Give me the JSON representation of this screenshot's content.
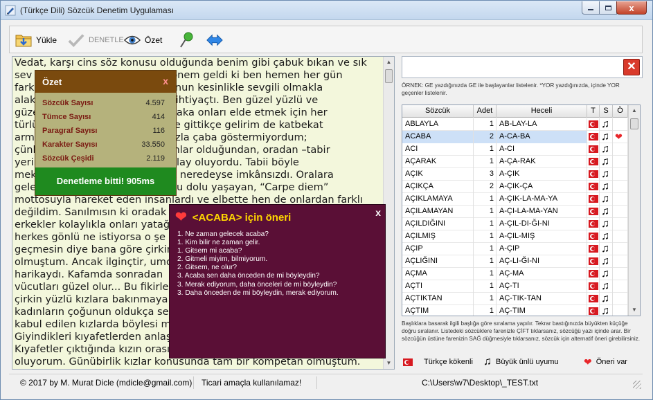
{
  "window": {
    "title": "(Türkçe Dili) Sözcük Denetim Uygulaması",
    "close_glyph": "x",
    "icon": "pen-icon"
  },
  "toolbar": {
    "load_label": "Yükle",
    "check_label": "DENETLE",
    "summary_label": "Özet",
    "icons": [
      "folder-icon",
      "checkmark-icon",
      "eye-icon",
      "pin-icon",
      "swap-arrows-icon"
    ]
  },
  "editor": {
    "lines": [
      "Vedat, karşı cins söz konusu olduğunda benim gibi çabuk bıkan ve sık",
      "sev                                ta bir dönem geldi ki ben hemen her gün",
      "fark                               n. Ve bunun kesinlikle sevgili olmakla",
      "alak                               nsel bir ihtiyaçtı. Ben güzel yüzlü ve",
      "güzel                              ve mutlaka onları elde etmek için her",
      "türlü                              iyi yönde gittikçe gelirim de katbekat",
      "arm                                r için fazla çaba göstermiyordum;",
      "çünk                               t mekânlar olduğundan, oradan –tabir",
      "yerin                              daha kolay oluyordu. Tabii böyle",
      "mek                                bulmak neredeyse imkânsızdı. Oralara",
      "gele                               atını dolu dolu yaşayan, “Carpe diem”",
      "mottosuyla hareket eden insanlardı ve elbette hen de onlardan farklı",
      "değildim. Sanılmısın ki oradak",
      "erkekler kolaylıkla onları yatağ",
      "herkes gönlü ne istiyorsa o şe",
      "geçmesin diye bana göre çirkin",
      "olmuştum. Ancak ilginçtir, umo",
      "harikaydı. Kafamda sonradan",
      "vücutları güzel olur... Bu fikirle,",
      "çirkin yüzlü kızlara bakınmaya",
      "kadınların çoğunun oldukça sel",
      "kabul edilen kızlarda böylesi m",
      "Giyindikleri kıyafetlerden anlaşı",
      "Kıyafetler çıktığında kızın orası",
      "oluyorum. Günübirlik kızlar konusunda tam bir kompetan olmuştum."
    ]
  },
  "summary": {
    "title": "Özet",
    "close": "x",
    "rows": [
      {
        "label": "Sözcük Sayısı",
        "value": "4.597"
      },
      {
        "label": "Tümce Sayısı",
        "value": "414"
      },
      {
        "label": "Paragraf Sayısı",
        "value": "116"
      },
      {
        "label": "Karakter Sayısı",
        "value": "33.550"
      },
      {
        "label": "Sözcük Çeşidi",
        "value": "2.119"
      }
    ],
    "footer": "Denetleme bitti! 905ms"
  },
  "suggestions": {
    "title": "<ACABA> için öneri",
    "close": "x",
    "items": [
      "1. Ne zaman gelecek acaba?",
      "1. Kim bilir ne zaman gelir.",
      "1. Gitsem mi acaba?",
      "2. Gitmeli miyim, bilmiyorum.",
      "2. Gitsem, ne olur?",
      "3. Acaba sen daha önceden de mi böyleydin?",
      "3. Merak ediyorum, daha önceleri de mi böyleydin?",
      "3. Daha önceden de mi böyleydin, merak ediyorum."
    ]
  },
  "search": {
    "value": "",
    "clear_glyph": "✕",
    "hint": "ÖRNEK: GE yazdığınızda GE ile başlayanlar listelenir. *YOR yazdığınızda, içinde YOR geçenler listelenir."
  },
  "grid": {
    "columns": [
      "Sözcük",
      "Adet",
      "Heceli",
      "T",
      "S",
      "Ö"
    ],
    "selected_row": 1,
    "rows": [
      {
        "word": "ABLAYLA",
        "count": "1",
        "syll": "AB-LAY-LA",
        "turkish": true,
        "harmony": true,
        "suggestion": false
      },
      {
        "word": "ACABA",
        "count": "2",
        "syll": "A-CA-BA",
        "turkish": true,
        "harmony": true,
        "suggestion": true
      },
      {
        "word": "ACI",
        "count": "1",
        "syll": "A-CI",
        "turkish": true,
        "harmony": true,
        "suggestion": false
      },
      {
        "word": "AÇARAK",
        "count": "1",
        "syll": "A-ÇA-RAK",
        "turkish": true,
        "harmony": true,
        "suggestion": false
      },
      {
        "word": "AÇIK",
        "count": "3",
        "syll": "A-ÇIK",
        "turkish": true,
        "harmony": true,
        "suggestion": false
      },
      {
        "word": "AÇIKÇA",
        "count": "2",
        "syll": "A-ÇIK-ÇA",
        "turkish": true,
        "harmony": true,
        "suggestion": false
      },
      {
        "word": "AÇIKLAMAYA",
        "count": "1",
        "syll": "A-ÇIK-LA-MA-YA",
        "turkish": true,
        "harmony": true,
        "suggestion": false
      },
      {
        "word": "AÇILAMAYAN",
        "count": "1",
        "syll": "A-ÇI-LA-MA-YAN",
        "turkish": true,
        "harmony": true,
        "suggestion": false
      },
      {
        "word": "AÇILDIĞINI",
        "count": "1",
        "syll": "A-ÇIL-DI-ĞI-NI",
        "turkish": true,
        "harmony": true,
        "suggestion": false
      },
      {
        "word": "AÇILMIŞ",
        "count": "1",
        "syll": "A-ÇIL-MIŞ",
        "turkish": true,
        "harmony": true,
        "suggestion": false
      },
      {
        "word": "AÇIP",
        "count": "1",
        "syll": "A-ÇIP",
        "turkish": true,
        "harmony": true,
        "suggestion": false
      },
      {
        "word": "AÇLIĞINI",
        "count": "1",
        "syll": "AÇ-LI-ĞI-NI",
        "turkish": true,
        "harmony": true,
        "suggestion": false
      },
      {
        "word": "AÇMA",
        "count": "1",
        "syll": "AÇ-MA",
        "turkish": true,
        "harmony": true,
        "suggestion": false
      },
      {
        "word": "AÇTI",
        "count": "1",
        "syll": "AÇ-TI",
        "turkish": true,
        "harmony": true,
        "suggestion": false
      },
      {
        "word": "AÇTIKTAN",
        "count": "1",
        "syll": "AÇ-TIK-TAN",
        "turkish": true,
        "harmony": true,
        "suggestion": false
      },
      {
        "word": "AÇTIM",
        "count": "1",
        "syll": "AÇ-TIM",
        "turkish": true,
        "harmony": true,
        "suggestion": false
      }
    ]
  },
  "footnote": "Başlıklara basarak ilgili başlığa göre sıralama yapılır. Tekrar bastığınızda büyükten küçüğe doğru sıralanır. Listedeki sözcüklere farenizle ÇİFT tıklarsanız, sözcüğü yazı içinde arar. Bir sözcüğün üstüne farenizin SAĞ düğmesiyle tıklarsanız, sözcük için alternatif öneri girebilirsiniz.",
  "legend": {
    "turkish": "Türkçe kökenli",
    "harmony": "Büyük ünlü uyumu",
    "suggestion": "Öneri var"
  },
  "status": {
    "copyright": "© 2017 by M. Murat Dicle (mdicle@gmail.com)",
    "license": "Ticari amaçla kullanılamaz!",
    "file": "C:\\Users\\w7\\Desktop\\_TEST.txt"
  },
  "colors": {
    "editor_bg": "#f3f7dc",
    "summary_header": "#7a4a0e",
    "summary_footer": "#1f8a1f",
    "suggest_bg": "#5a0f36",
    "suggest_title": "#ffd700",
    "selection": "#cde0f7"
  }
}
